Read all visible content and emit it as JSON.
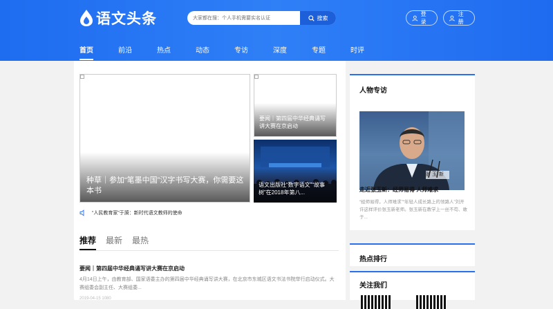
{
  "brand": {
    "name": "语文头条"
  },
  "search": {
    "placeholder": "大家都在搜：个人手机需要实名认证",
    "button_label": "搜索"
  },
  "header_buttons": {
    "login": "登录",
    "register": "注册"
  },
  "nav": {
    "items": [
      "首页",
      "前沿",
      "热点",
      "动态",
      "专访",
      "深度",
      "专题",
      "时评"
    ],
    "active": "首页"
  },
  "featured": {
    "main_caption": "种草｜参加“笔墨中国”汉字书写大赛，你需要这本书",
    "top_right_caption": "要闻｜第四届中华经典诵写讲大赛在京启动",
    "bottom_right_caption": "语文出版社“数字语文”“故事树”在2018年第八..."
  },
  "notice": {
    "text": "“人民教育家”于漪：新时代语文教师的使命"
  },
  "feed_tabs": {
    "items": [
      "推荐",
      "最新",
      "最热"
    ],
    "active": "推荐"
  },
  "article": {
    "title": "要闻｜第四届中华经典诵写讲大赛在京启动",
    "summary": "4月14日上午，由教育部、国家语委主办的第四届中华经典诵写讲大赛，在北京市东城区语文书法书院举行启动仪式。大赛组委会副主任、大赛组委...",
    "meta": "2019-04-15   1080"
  },
  "sidebar": {
    "interview": {
      "title": "人物专访",
      "photo_label": "张玉新",
      "headline": "走近张玉新：经师易得 人师难求",
      "excerpt": "“经师易得，人师难求”“年轻人成长路上的领路人”刘开许这样评价张玉新老师。张玉新在教学上一丝不苟、敢于..."
    },
    "ranking": {
      "title": "热点排行"
    },
    "contact": {
      "title": "关注我们"
    }
  },
  "colors": {
    "brand_blue": "#2a74f3",
    "accent": "#2a6ef0"
  }
}
